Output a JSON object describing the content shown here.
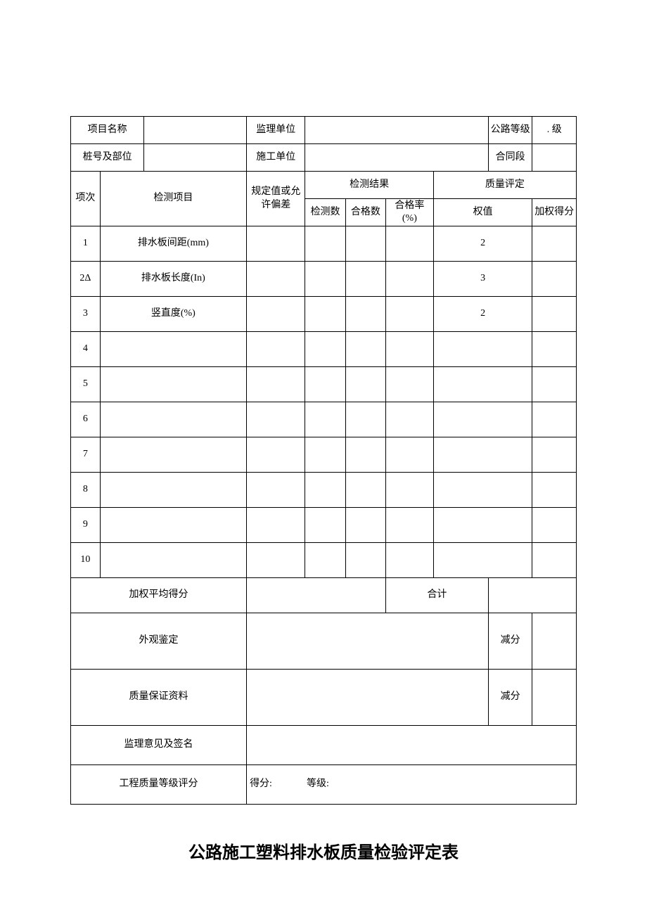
{
  "header": {
    "project_name_label": "项目名称",
    "project_name_value": "",
    "supervision_unit_label": "监理单位",
    "supervision_unit_value": "",
    "road_grade_label": "公路等级",
    "road_grade_value": ". 级",
    "station_label": "桩号及部位",
    "station_value": "",
    "construction_unit_label": "施工单位",
    "construction_unit_value": "",
    "contract_section_label": "合同段",
    "contract_section_value": ""
  },
  "columns": {
    "item_no": "项次",
    "inspection_item": "检测项目",
    "spec_or_tolerance": "规定值或允许偏差",
    "inspection_results": "检测结果",
    "inspect_count": "检测数",
    "pass_count": "合格数",
    "pass_rate": "合格率(%)",
    "quality_eval": "质量评定",
    "weight": "权值",
    "weighted_score": "加权得分"
  },
  "rows": [
    {
      "no": "1",
      "item": "排水板间距(mm)",
      "spec": "",
      "inspect": "",
      "pass": "",
      "rate": "",
      "weight": "2",
      "score": ""
    },
    {
      "no": "2Δ",
      "item": "排水板长度(In)",
      "spec": "",
      "inspect": "",
      "pass": "",
      "rate": "",
      "weight": "3",
      "score": ""
    },
    {
      "no": "3",
      "item": "竖直度(%)",
      "spec": "",
      "inspect": "",
      "pass": "",
      "rate": "",
      "weight": "2",
      "score": ""
    },
    {
      "no": "4",
      "item": "",
      "spec": "",
      "inspect": "",
      "pass": "",
      "rate": "",
      "weight": "",
      "score": ""
    },
    {
      "no": "5",
      "item": "",
      "spec": "",
      "inspect": "",
      "pass": "",
      "rate": "",
      "weight": "",
      "score": ""
    },
    {
      "no": "6",
      "item": "",
      "spec": "",
      "inspect": "",
      "pass": "",
      "rate": "",
      "weight": "",
      "score": ""
    },
    {
      "no": "7",
      "item": "",
      "spec": "",
      "inspect": "",
      "pass": "",
      "rate": "",
      "weight": "",
      "score": ""
    },
    {
      "no": "8",
      "item": "",
      "spec": "",
      "inspect": "",
      "pass": "",
      "rate": "",
      "weight": "",
      "score": ""
    },
    {
      "no": "9",
      "item": "",
      "spec": "",
      "inspect": "",
      "pass": "",
      "rate": "",
      "weight": "",
      "score": ""
    },
    {
      "no": "10",
      "item": "",
      "spec": "",
      "inspect": "",
      "pass": "",
      "rate": "",
      "weight": "",
      "score": ""
    }
  ],
  "footer": {
    "weighted_avg_label": "加权平均得分",
    "weighted_avg_value": "",
    "total_label": "合计",
    "total_value": "",
    "appearance_label": "外观鉴定",
    "appearance_value": "",
    "deduct_label_a": "减分",
    "deduct_value_a": "",
    "qa_docs_label": "质量保证资料",
    "qa_docs_value": "",
    "deduct_label_b": "减分",
    "deduct_value_b": "",
    "supervisor_opinion_label": "监理意见及签名",
    "supervisor_opinion_value": "",
    "quality_grade_label": "工程质量等级评分",
    "score_text": "得分:",
    "grade_text": "等级:"
  },
  "title": "公路施工塑料排水板质量检验评定表"
}
